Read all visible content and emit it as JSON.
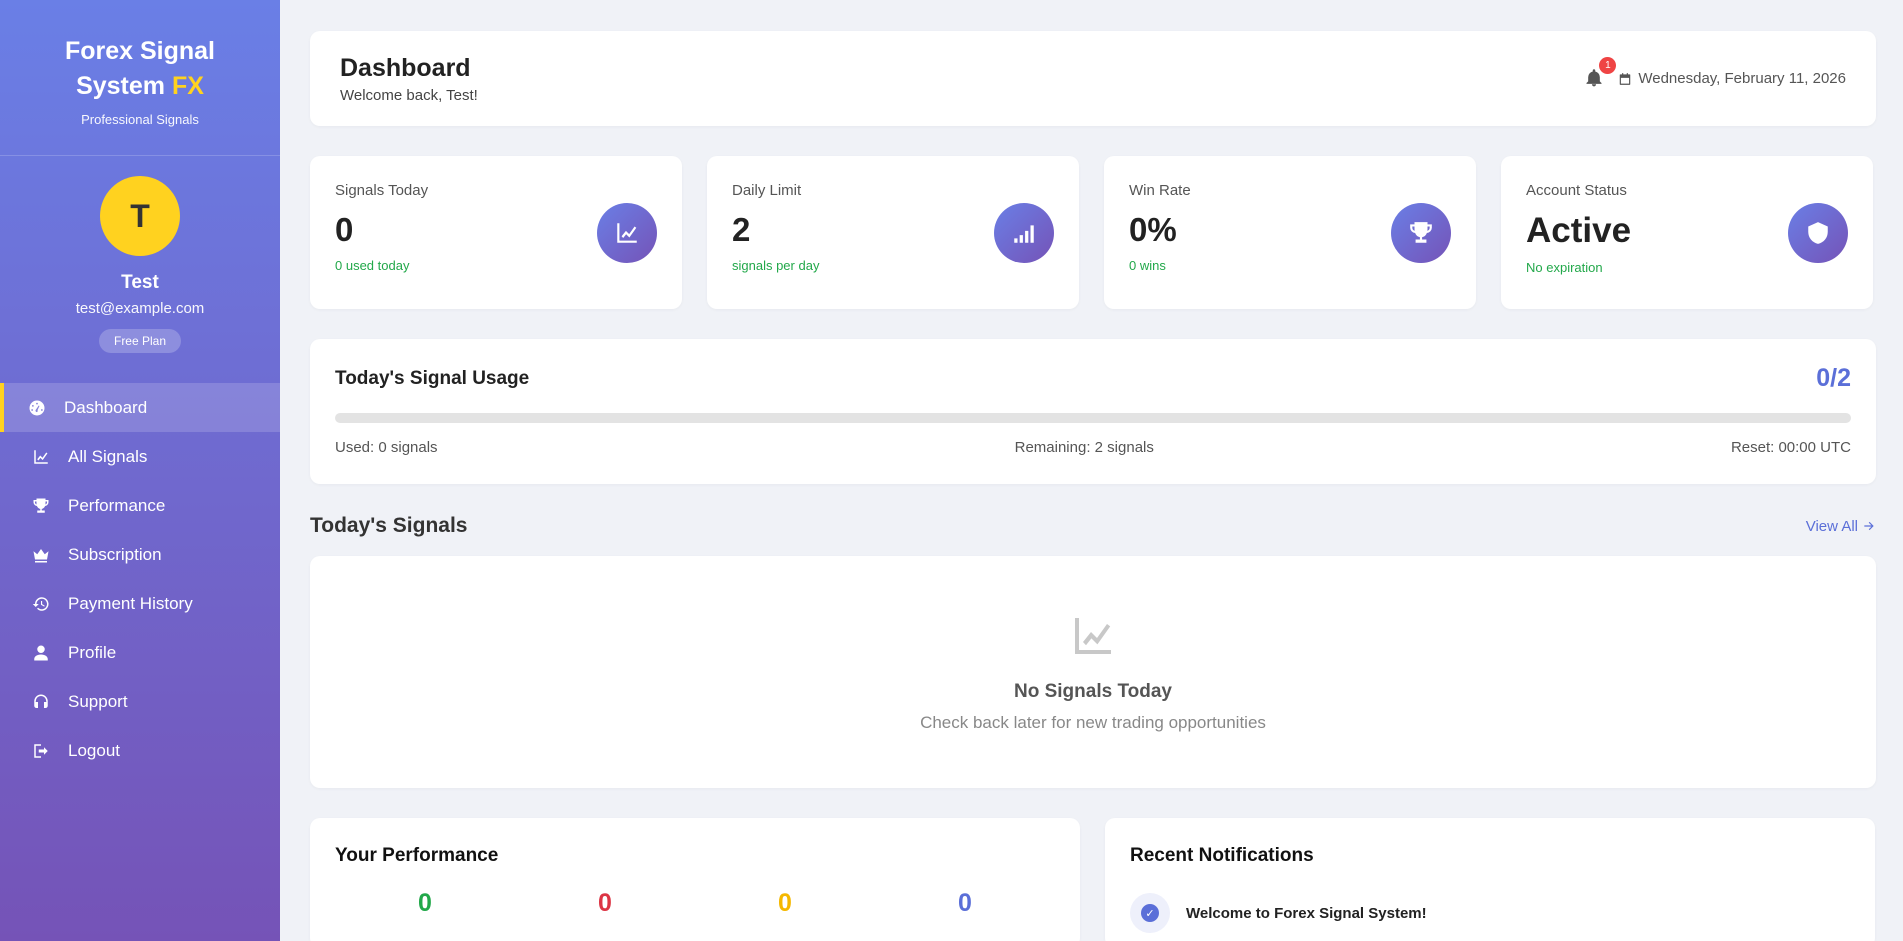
{
  "brand": {
    "title_line1": "Forex Signal",
    "title_line2": "System",
    "title_accent": "FX",
    "subtitle": "Professional Signals"
  },
  "user": {
    "initial": "T",
    "name": "Test",
    "email": "test@example.com",
    "plan": "Free Plan"
  },
  "nav": [
    {
      "label": "Dashboard",
      "icon": "dashboard-gauge-icon",
      "active": true
    },
    {
      "label": "All Signals",
      "icon": "line-chart-icon"
    },
    {
      "label": "Performance",
      "icon": "trophy-icon"
    },
    {
      "label": "Subscription",
      "icon": "crown-icon"
    },
    {
      "label": "Payment History",
      "icon": "history-icon"
    },
    {
      "label": "Profile",
      "icon": "user-icon"
    },
    {
      "label": "Support",
      "icon": "headset-icon"
    },
    {
      "label": "Logout",
      "icon": "logout-icon"
    }
  ],
  "header": {
    "title": "Dashboard",
    "welcome": "Welcome back, Test!",
    "notification_count": "1",
    "date": "Wednesday, February 11, 2026"
  },
  "stats": [
    {
      "label": "Signals Today",
      "value": "0",
      "sub": "0 used today",
      "icon": "line-chart-icon"
    },
    {
      "label": "Daily Limit",
      "value": "2",
      "sub": "signals per day",
      "icon": "signal-bars-icon"
    },
    {
      "label": "Win Rate",
      "value": "0%",
      "sub": "0 wins",
      "icon": "trophy-icon"
    },
    {
      "label": "Account Status",
      "value": "Active",
      "sub": "No expiration",
      "icon": "shield-icon"
    }
  ],
  "usage": {
    "title": "Today's Signal Usage",
    "count": "0/2",
    "progress_fraction": 0,
    "used": "Used: 0 signals",
    "remaining": "Remaining: 2 signals",
    "reset": "Reset: 00:00 UTC"
  },
  "signals": {
    "title": "Today's Signals",
    "view_all": "View All",
    "empty_title": "No Signals Today",
    "empty_sub": "Check back later for new trading opportunities"
  },
  "performance": {
    "title": "Your Performance",
    "values": [
      {
        "value": "0",
        "color": "#22a84a"
      },
      {
        "value": "0",
        "color": "#dc3545"
      },
      {
        "value": "0",
        "color": "#f5b800"
      },
      {
        "value": "0",
        "color": "#5b6fd8"
      }
    ]
  },
  "notifications": {
    "title": "Recent Notifications",
    "items": [
      {
        "text": "Welcome to Forex Signal System!"
      }
    ]
  },
  "colors": {
    "accent": "#5b6fd8",
    "brand_yellow": "#ffd21f",
    "success": "#22a84a"
  }
}
